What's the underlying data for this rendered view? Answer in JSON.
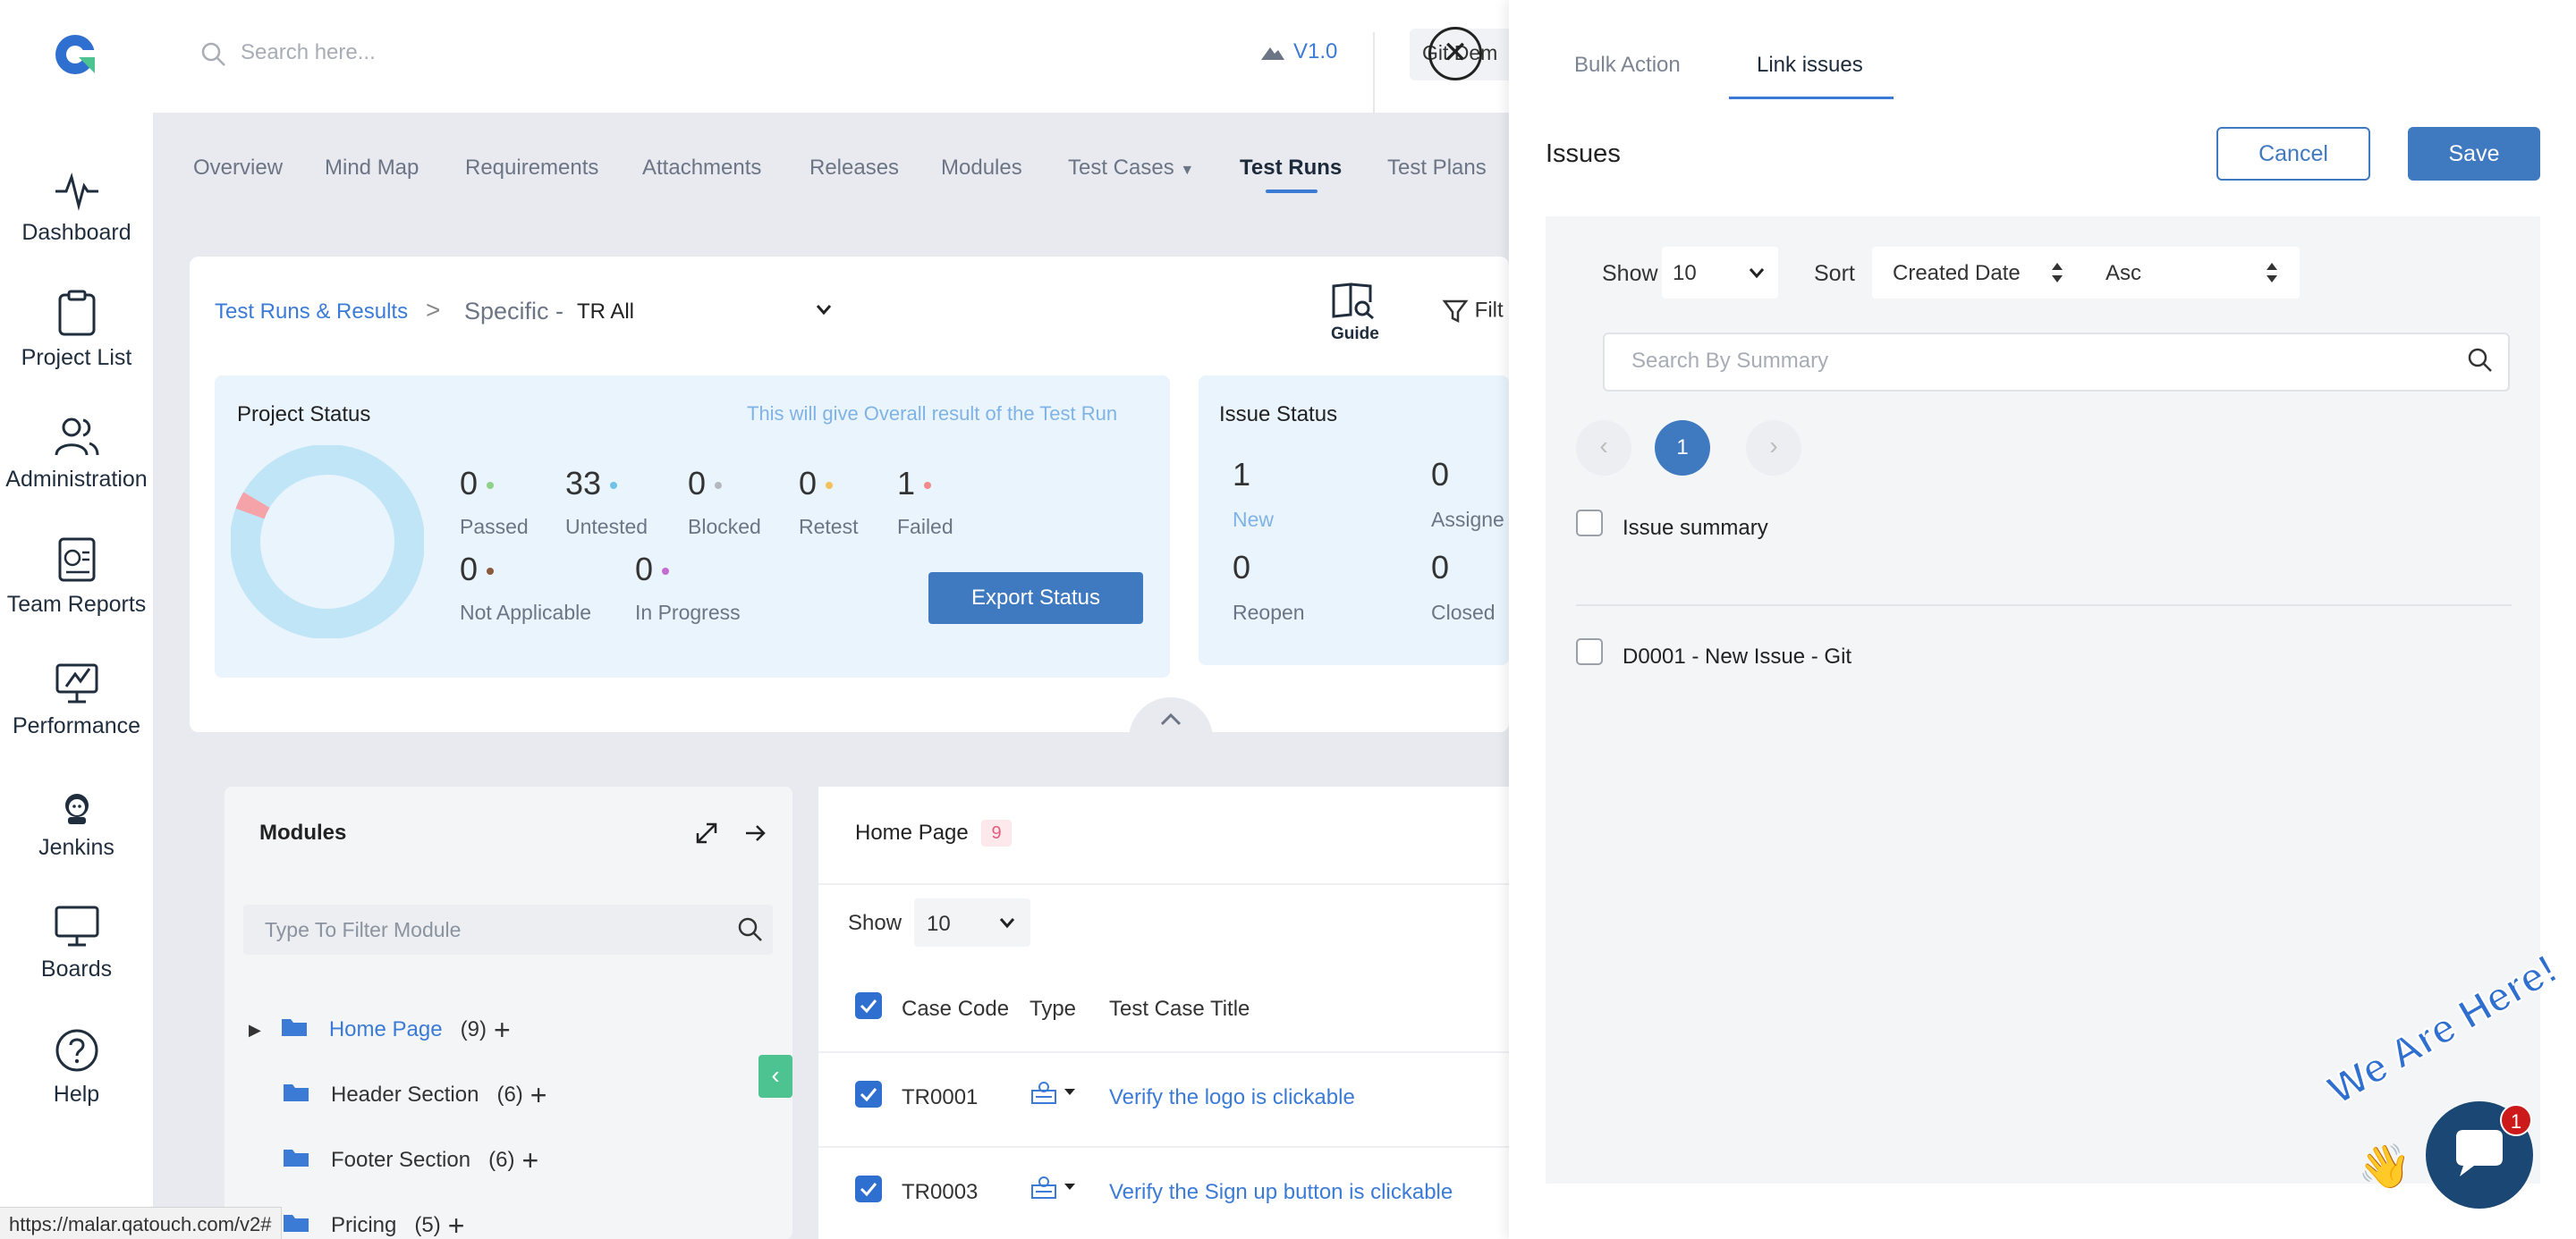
{
  "sidebar": {
    "items": [
      {
        "label": "Dashboard",
        "icon": "pulse-icon"
      },
      {
        "label": "Project List",
        "icon": "clipboard-icon"
      },
      {
        "label": "Administration",
        "icon": "users-icon"
      },
      {
        "label": "Team Reports",
        "icon": "report-icon"
      },
      {
        "label": "Performance",
        "icon": "performance-icon"
      },
      {
        "label": "Jenkins",
        "icon": "jenkins-icon"
      },
      {
        "label": "Boards",
        "icon": "board-icon"
      },
      {
        "label": "Help",
        "icon": "help-icon"
      }
    ]
  },
  "header": {
    "search_placeholder": "Search here...",
    "version": "V1.0",
    "project_chip": "Git Dem"
  },
  "nav": {
    "tabs": [
      "Overview",
      "Mind Map",
      "Requirements",
      "Attachments",
      "Releases",
      "Modules",
      "Test Cases",
      "Test Runs",
      "Test Plans"
    ],
    "active": "Test Runs"
  },
  "breadcrumb": {
    "link": "Test Runs & Results",
    "separator": ">",
    "specific": "Specific -",
    "selected": "TR All"
  },
  "toolbar": {
    "guide": "Guide",
    "filter": "Filt"
  },
  "project_status": {
    "title": "Project Status",
    "note": "This will give Overall result of the Test Run",
    "stats": [
      {
        "value": "0",
        "label": "Passed",
        "color": "#8fd18a"
      },
      {
        "value": "33",
        "label": "Untested",
        "color": "#6fc3ea"
      },
      {
        "value": "0",
        "label": "Blocked",
        "color": "#b5b9be"
      },
      {
        "value": "0",
        "label": "Retest",
        "color": "#f6c15a"
      },
      {
        "value": "1",
        "label": "Failed",
        "color": "#f18a8a"
      },
      {
        "value": "0",
        "label": "Not Applicable",
        "color": "#8a5a3c"
      },
      {
        "value": "0",
        "label": "In Progress",
        "color": "#c46bd1"
      }
    ],
    "export_label": "Export Status"
  },
  "issue_status": {
    "title": "Issue Status",
    "stats": [
      {
        "value": "1",
        "label": "New"
      },
      {
        "value": "0",
        "label": "Assigne"
      },
      {
        "value": "0",
        "label": "Reopen"
      },
      {
        "value": "0",
        "label": "Closed"
      }
    ]
  },
  "modules": {
    "title": "Modules",
    "filter_placeholder": "Type To Filter Module",
    "tree": [
      {
        "name": "Home Page",
        "count": "(9)"
      },
      {
        "name": "Header Section",
        "count": "(6)"
      },
      {
        "name": "Footer Section",
        "count": "(6)"
      },
      {
        "name": "Pricing",
        "count": "(5)"
      }
    ]
  },
  "testcases": {
    "title": "Home Page",
    "count": "9",
    "show_label": "Show",
    "show_value": "10",
    "headers": [
      "Case Code",
      "Type",
      "Test Case Title"
    ],
    "rows": [
      {
        "code": "TR0001",
        "title": "Verify the logo is clickable"
      },
      {
        "code": "TR0003",
        "title": "Verify the Sign up button is clickable"
      }
    ]
  },
  "status_url": "https://malar.qatouch.com/v2#",
  "drawer": {
    "tabs": [
      "Bulk Action",
      "Link issues"
    ],
    "active_tab": "Link issues",
    "title": "Issues",
    "cancel": "Cancel",
    "save": "Save",
    "show_label": "Show",
    "show_value": "10",
    "sort_label": "Sort",
    "sort_field": "Created Date",
    "sort_order": "Asc",
    "search_placeholder": "Search By Summary",
    "prev": "‹",
    "page": "1",
    "next": "›",
    "header_label": "Issue summary",
    "issues": [
      "D0001 - New Issue - Git"
    ]
  },
  "chat": {
    "tagline": "We Are Here!",
    "badge": "1"
  },
  "colors": {
    "primary": "#3f79c0",
    "link": "#3b7bd6",
    "accent_green": "#4cc390"
  }
}
